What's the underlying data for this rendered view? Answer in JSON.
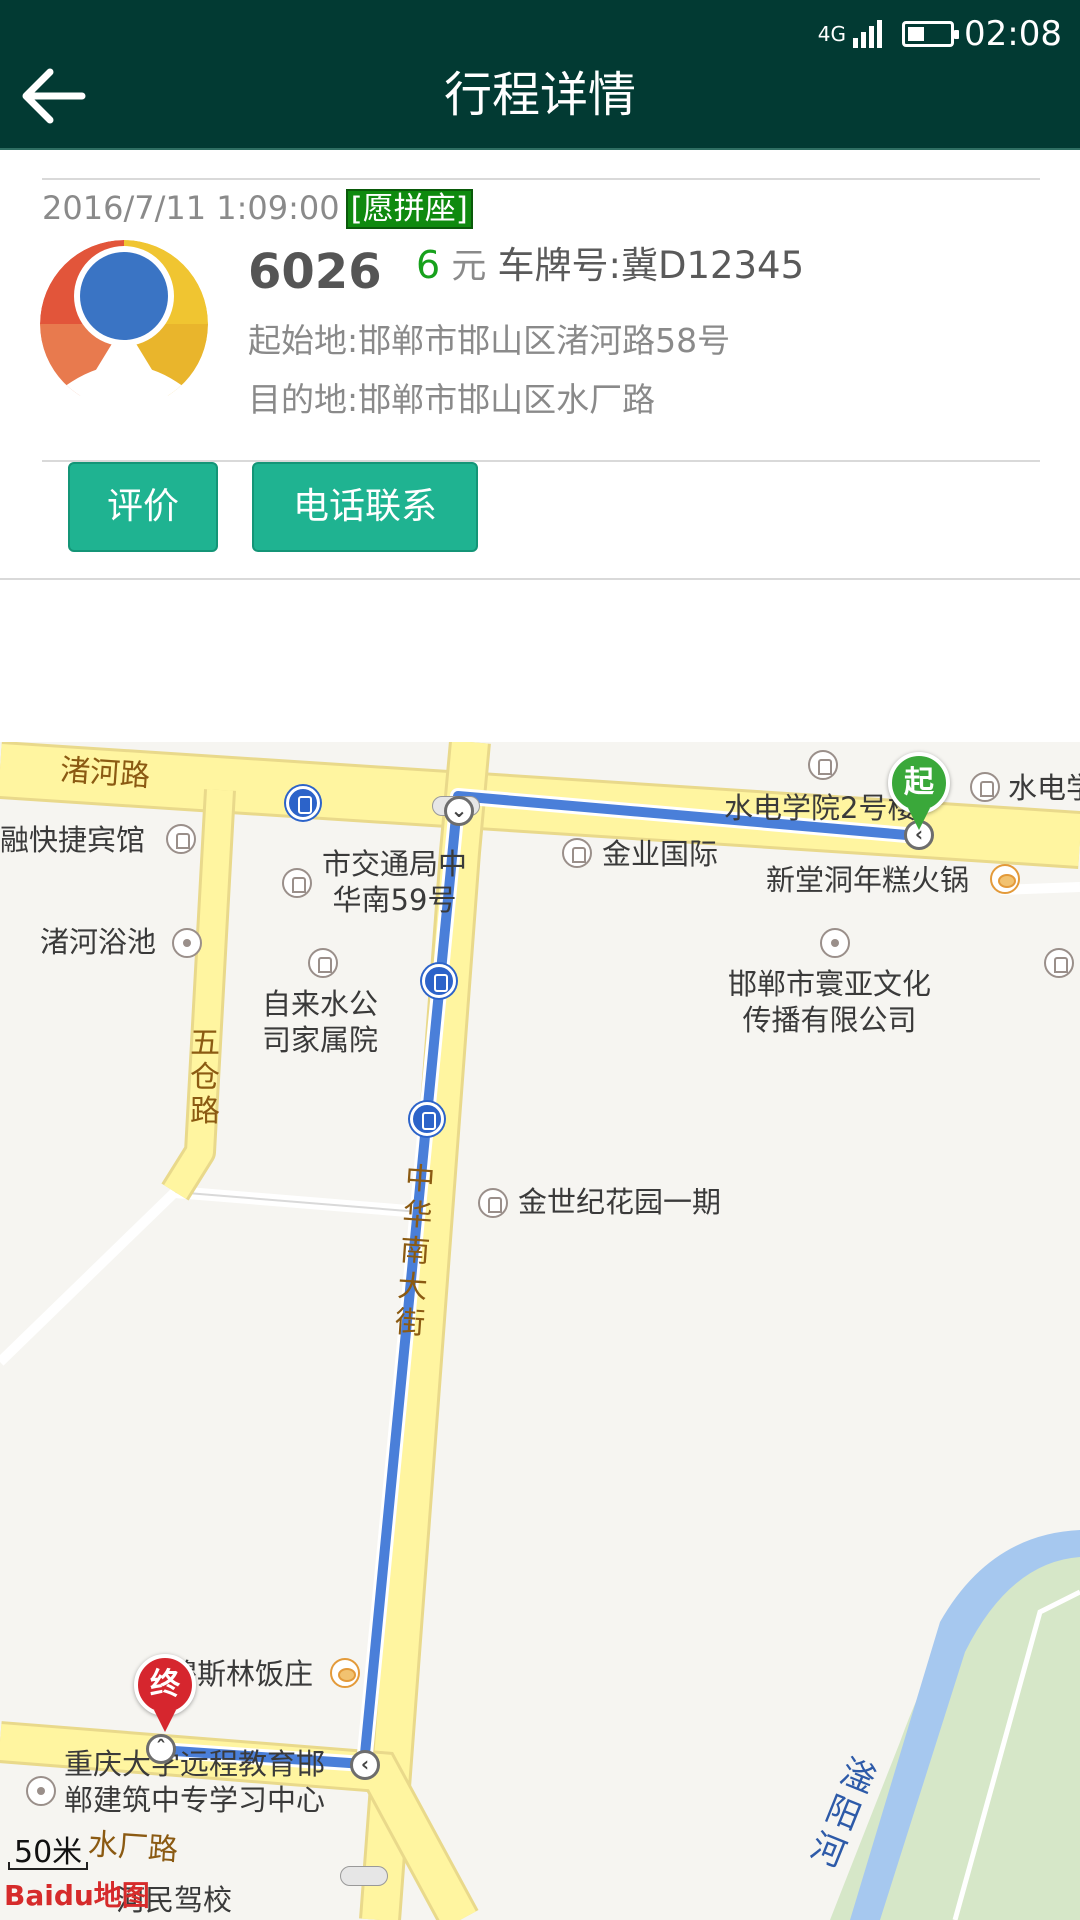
{
  "status_bar": {
    "network": "4G",
    "time": "02:08"
  },
  "header": {
    "title": "行程详情",
    "back_icon": "back-arrow-icon"
  },
  "trip": {
    "datetime": "2016/7/11 1:09:00",
    "carpool_tag": "[愿拼座]",
    "driver_number": "6026",
    "price": "6",
    "currency": "元",
    "plate": "车牌号:冀D12345",
    "start_label": "起始地:",
    "start_address": "邯郸市邯山区渚河路58号",
    "end_label": "目的地:",
    "end_address": "邯郸市邯山区水厂路"
  },
  "actions": {
    "rate_label": "评价",
    "call_label": "电话联系"
  },
  "colors": {
    "header_bg": "#023a33",
    "button_bg": "#1fb391",
    "price": "#17a11c",
    "tag_bg": "#0f8a0f",
    "route": "#4a7fd9",
    "start_pin": "#3aa83a",
    "end_pin": "#d6262e"
  },
  "map": {
    "roads": {
      "zhuhe": "渚河路",
      "wucang": "五仓路",
      "zhonghua": "中华南大街",
      "shuichang": "水厂路",
      "river": "滏阳河"
    },
    "pois": {
      "hotel": "融快捷宾馆",
      "bathhouse": "渚河浴池",
      "transport_bureau": "市交通局中\n华南59号",
      "waterworks": "自来水公\n司家属院",
      "jinye": "金业国际",
      "hydro_school": "水电学院2号楼",
      "hydro_right": "水电学",
      "hotpot": "新堂洞年糕火锅",
      "culture_co": "邯郸市寰亚文化\n传播有限公司",
      "jinshiji": "金世纪花园一期",
      "muslim": "穆斯林饭庄",
      "chongqing": "重庆大学远程教育邯\n郸建筑中专学习中心",
      "driving_school": "河民驾校"
    },
    "start_marker": "起",
    "end_marker": "终",
    "scale": "50米",
    "logo": "Baidu地图"
  }
}
